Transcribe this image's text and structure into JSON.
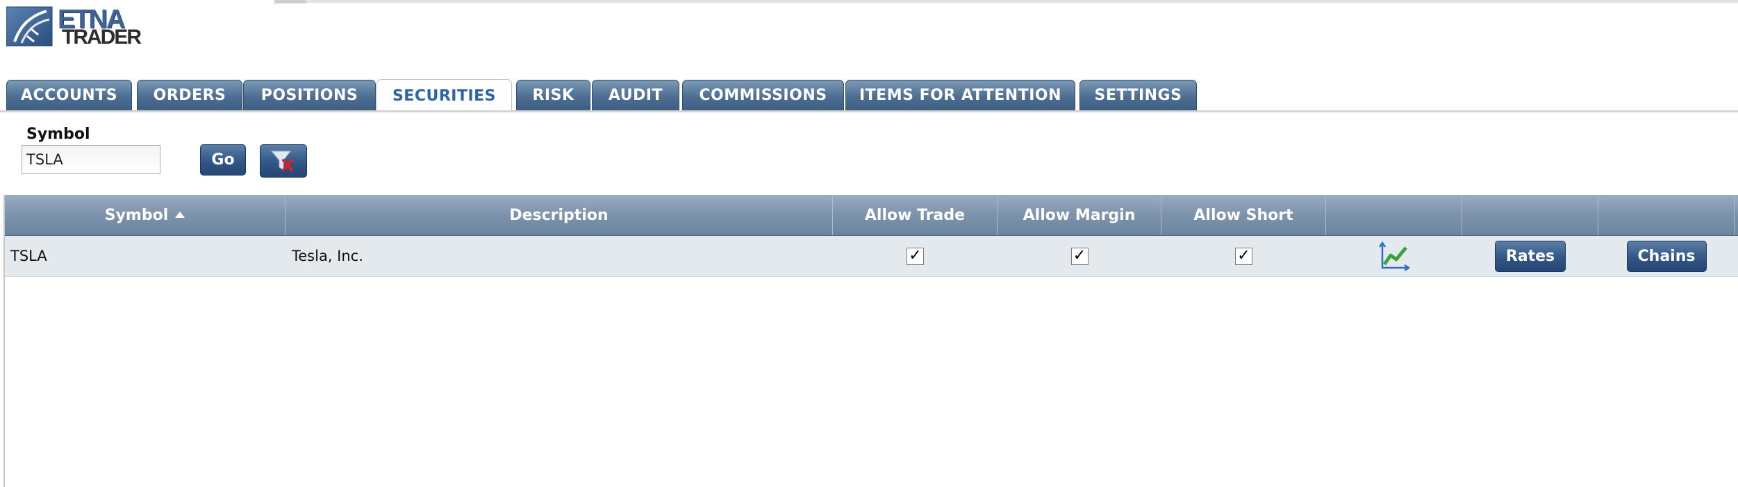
{
  "logo": {
    "line1": "ETNA",
    "line2": "TRADER"
  },
  "tabs": [
    {
      "label": "ACCOUNTS"
    },
    {
      "label": "ORDERS"
    },
    {
      "label": "POSITIONS"
    },
    {
      "label": "SECURITIES",
      "active": true
    },
    {
      "label": "RISK"
    },
    {
      "label": "AUDIT"
    },
    {
      "label": "COMMISSIONS"
    },
    {
      "label": "ITEMS FOR ATTENTION"
    },
    {
      "label": "SETTINGS"
    }
  ],
  "filter": {
    "label": "Symbol",
    "value": "TSLA",
    "go_label": "Go",
    "clear_icon": "clear-filter-icon"
  },
  "grid": {
    "columns": [
      "Symbol",
      "Description",
      "Allow Trade",
      "Allow Margin",
      "Allow Short",
      "",
      "",
      ""
    ],
    "sort": {
      "column": "Symbol",
      "direction": "ascending"
    },
    "rows": [
      {
        "symbol": "TSLA",
        "description": "Tesla, Inc.",
        "allow_trade": "✓",
        "allow_margin": "✓",
        "allow_short": "✓",
        "chart_icon": "chart-icon",
        "rates_label": "Rates",
        "chains_label": "Chains"
      }
    ]
  },
  "colors": {
    "tab_bg": "#4d6e92",
    "active_tab_text": "#2a63a8",
    "button_bg": "#2f5383",
    "header_bg": "#7c93ab",
    "row_bg": "#e4e9ee"
  }
}
